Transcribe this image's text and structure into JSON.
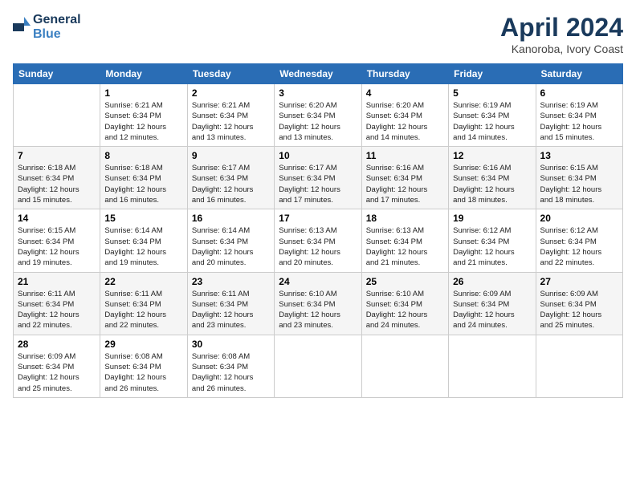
{
  "header": {
    "logo_general": "General",
    "logo_blue": "Blue",
    "title": "April 2024",
    "subtitle": "Kanoroba, Ivory Coast"
  },
  "columns": [
    "Sunday",
    "Monday",
    "Tuesday",
    "Wednesday",
    "Thursday",
    "Friday",
    "Saturday"
  ],
  "weeks": [
    [
      {
        "day": "",
        "info": ""
      },
      {
        "day": "1",
        "info": "Sunrise: 6:21 AM\nSunset: 6:34 PM\nDaylight: 12 hours\nand 12 minutes."
      },
      {
        "day": "2",
        "info": "Sunrise: 6:21 AM\nSunset: 6:34 PM\nDaylight: 12 hours\nand 13 minutes."
      },
      {
        "day": "3",
        "info": "Sunrise: 6:20 AM\nSunset: 6:34 PM\nDaylight: 12 hours\nand 13 minutes."
      },
      {
        "day": "4",
        "info": "Sunrise: 6:20 AM\nSunset: 6:34 PM\nDaylight: 12 hours\nand 14 minutes."
      },
      {
        "day": "5",
        "info": "Sunrise: 6:19 AM\nSunset: 6:34 PM\nDaylight: 12 hours\nand 14 minutes."
      },
      {
        "day": "6",
        "info": "Sunrise: 6:19 AM\nSunset: 6:34 PM\nDaylight: 12 hours\nand 15 minutes."
      }
    ],
    [
      {
        "day": "7",
        "info": "Sunrise: 6:18 AM\nSunset: 6:34 PM\nDaylight: 12 hours\nand 15 minutes."
      },
      {
        "day": "8",
        "info": "Sunrise: 6:18 AM\nSunset: 6:34 PM\nDaylight: 12 hours\nand 16 minutes."
      },
      {
        "day": "9",
        "info": "Sunrise: 6:17 AM\nSunset: 6:34 PM\nDaylight: 12 hours\nand 16 minutes."
      },
      {
        "day": "10",
        "info": "Sunrise: 6:17 AM\nSunset: 6:34 PM\nDaylight: 12 hours\nand 17 minutes."
      },
      {
        "day": "11",
        "info": "Sunrise: 6:16 AM\nSunset: 6:34 PM\nDaylight: 12 hours\nand 17 minutes."
      },
      {
        "day": "12",
        "info": "Sunrise: 6:16 AM\nSunset: 6:34 PM\nDaylight: 12 hours\nand 18 minutes."
      },
      {
        "day": "13",
        "info": "Sunrise: 6:15 AM\nSunset: 6:34 PM\nDaylight: 12 hours\nand 18 minutes."
      }
    ],
    [
      {
        "day": "14",
        "info": "Sunrise: 6:15 AM\nSunset: 6:34 PM\nDaylight: 12 hours\nand 19 minutes."
      },
      {
        "day": "15",
        "info": "Sunrise: 6:14 AM\nSunset: 6:34 PM\nDaylight: 12 hours\nand 19 minutes."
      },
      {
        "day": "16",
        "info": "Sunrise: 6:14 AM\nSunset: 6:34 PM\nDaylight: 12 hours\nand 20 minutes."
      },
      {
        "day": "17",
        "info": "Sunrise: 6:13 AM\nSunset: 6:34 PM\nDaylight: 12 hours\nand 20 minutes."
      },
      {
        "day": "18",
        "info": "Sunrise: 6:13 AM\nSunset: 6:34 PM\nDaylight: 12 hours\nand 21 minutes."
      },
      {
        "day": "19",
        "info": "Sunrise: 6:12 AM\nSunset: 6:34 PM\nDaylight: 12 hours\nand 21 minutes."
      },
      {
        "day": "20",
        "info": "Sunrise: 6:12 AM\nSunset: 6:34 PM\nDaylight: 12 hours\nand 22 minutes."
      }
    ],
    [
      {
        "day": "21",
        "info": "Sunrise: 6:11 AM\nSunset: 6:34 PM\nDaylight: 12 hours\nand 22 minutes."
      },
      {
        "day": "22",
        "info": "Sunrise: 6:11 AM\nSunset: 6:34 PM\nDaylight: 12 hours\nand 22 minutes."
      },
      {
        "day": "23",
        "info": "Sunrise: 6:11 AM\nSunset: 6:34 PM\nDaylight: 12 hours\nand 23 minutes."
      },
      {
        "day": "24",
        "info": "Sunrise: 6:10 AM\nSunset: 6:34 PM\nDaylight: 12 hours\nand 23 minutes."
      },
      {
        "day": "25",
        "info": "Sunrise: 6:10 AM\nSunset: 6:34 PM\nDaylight: 12 hours\nand 24 minutes."
      },
      {
        "day": "26",
        "info": "Sunrise: 6:09 AM\nSunset: 6:34 PM\nDaylight: 12 hours\nand 24 minutes."
      },
      {
        "day": "27",
        "info": "Sunrise: 6:09 AM\nSunset: 6:34 PM\nDaylight: 12 hours\nand 25 minutes."
      }
    ],
    [
      {
        "day": "28",
        "info": "Sunrise: 6:09 AM\nSunset: 6:34 PM\nDaylight: 12 hours\nand 25 minutes."
      },
      {
        "day": "29",
        "info": "Sunrise: 6:08 AM\nSunset: 6:34 PM\nDaylight: 12 hours\nand 26 minutes."
      },
      {
        "day": "30",
        "info": "Sunrise: 6:08 AM\nSunset: 6:34 PM\nDaylight: 12 hours\nand 26 minutes."
      },
      {
        "day": "",
        "info": ""
      },
      {
        "day": "",
        "info": ""
      },
      {
        "day": "",
        "info": ""
      },
      {
        "day": "",
        "info": ""
      }
    ]
  ]
}
